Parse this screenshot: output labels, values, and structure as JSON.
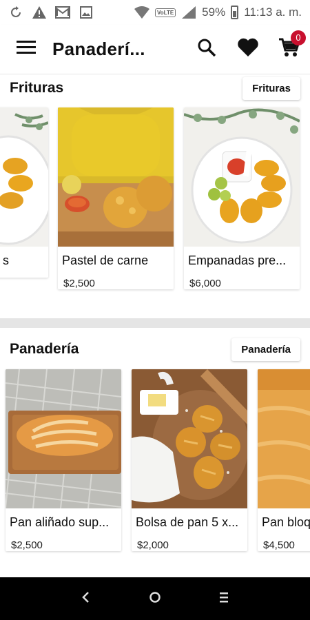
{
  "status_bar": {
    "battery": "59%",
    "time": "11:13 a. m.",
    "network": "VoLTE"
  },
  "app_bar": {
    "title": "Panaderí...",
    "cart_count": "0"
  },
  "sections": [
    {
      "title": "Frituras",
      "button": "Frituras",
      "products": [
        {
          "name": "s",
          "price": ""
        },
        {
          "name": "Pastel de carne",
          "price": "$2,500"
        },
        {
          "name": "Empanadas pre...",
          "price": "$6,000"
        }
      ]
    },
    {
      "title": "Panadería",
      "button": "Panadería",
      "products": [
        {
          "name": "Pan aliñado sup...",
          "price": "$2,500"
        },
        {
          "name": "Bolsa de pan 5 x...",
          "price": "$2,000"
        },
        {
          "name": "Pan bloq",
          "price": "$4,500"
        }
      ]
    }
  ],
  "colors": {
    "badge": "#c8102e",
    "divider": "#e5e5e5",
    "nav": "#000000"
  },
  "icons": [
    "menu-icon",
    "search-icon",
    "heart-icon",
    "cart-icon",
    "back-icon",
    "home-icon",
    "recents-icon"
  ]
}
